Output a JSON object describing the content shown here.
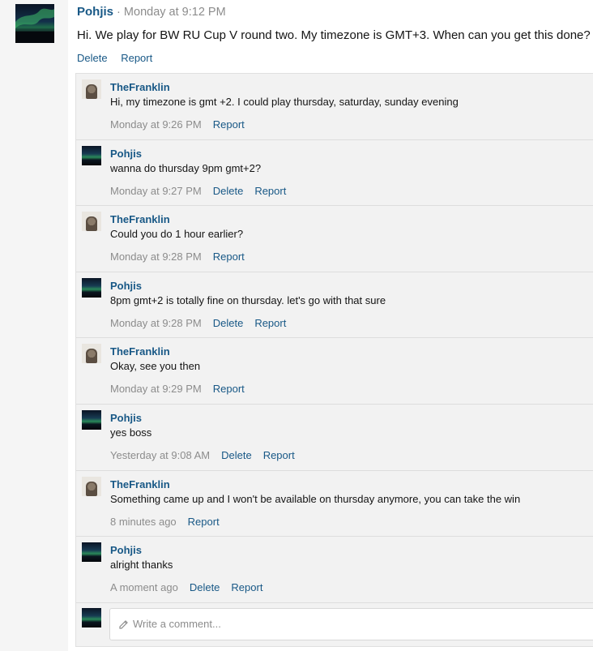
{
  "post": {
    "author": "Pohjis",
    "separator": "·",
    "time": "Monday at 9:12 PM",
    "body": "Hi. We play for BW RU Cup V round two. My timezone is GMT+3. When can you get this done?",
    "actions": {
      "delete": "Delete",
      "report": "Report"
    }
  },
  "comments": [
    {
      "author": "TheFranklin",
      "text": "Hi, my timezone is gmt +2. I could play thursday, saturday, sunday evening",
      "time": "Monday at 9:26 PM",
      "report": "Report"
    },
    {
      "author": "Pohjis",
      "text": "wanna do thursday 9pm gmt+2?",
      "time": "Monday at 9:27 PM",
      "delete": "Delete",
      "report": "Report"
    },
    {
      "author": "TheFranklin",
      "text": "Could you do 1 hour earlier?",
      "time": "Monday at 9:28 PM",
      "report": "Report"
    },
    {
      "author": "Pohjis",
      "text": "8pm gmt+2 is totally fine on thursday. let's go with that sure",
      "time": "Monday at 9:28 PM",
      "delete": "Delete",
      "report": "Report"
    },
    {
      "author": "TheFranklin",
      "text": "Okay, see you then",
      "time": "Monday at 9:29 PM",
      "report": "Report"
    },
    {
      "author": "Pohjis",
      "text": "yes boss",
      "time": "Yesterday at 9:08 AM",
      "delete": "Delete",
      "report": "Report"
    },
    {
      "author": "TheFranklin",
      "text": "Something came up and I won't be available on thursday anymore, you can take the win",
      "time": "8 minutes ago",
      "report": "Report"
    },
    {
      "author": "Pohjis",
      "text": "alright thanks",
      "time": "A moment ago",
      "delete": "Delete",
      "report": "Report"
    }
  ],
  "comment_box": {
    "placeholder": "Write a comment..."
  },
  "icons": {
    "pencil": "pencil-icon"
  },
  "colors": {
    "link": "#185886",
    "muted": "#8c8c8c",
    "panel": "#f2f2f2"
  }
}
